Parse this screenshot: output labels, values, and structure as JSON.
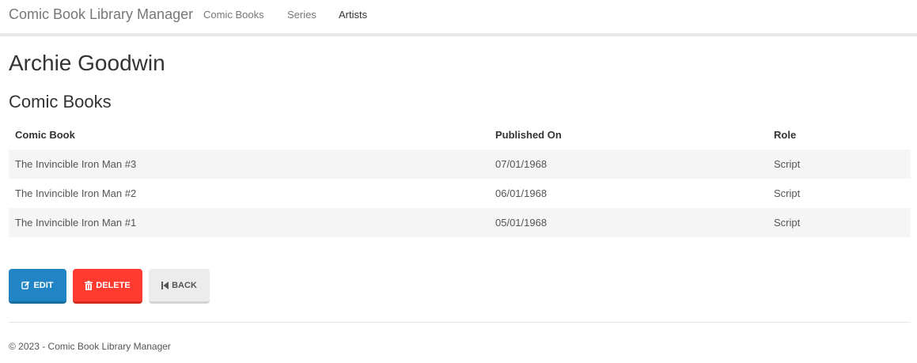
{
  "nav": {
    "brand": "Comic Book Library Manager",
    "links": [
      {
        "label": "Comic Books"
      },
      {
        "label": "Series"
      },
      {
        "label": "Artists"
      }
    ]
  },
  "page": {
    "title": "Archie Goodwin",
    "section_title": "Comic Books"
  },
  "table": {
    "headers": [
      "Comic Book",
      "Published On",
      "Role"
    ],
    "rows": [
      [
        "The Invincible Iron Man #3",
        "07/01/1968",
        "Script"
      ],
      [
        "The Invincible Iron Man #2",
        "06/01/1968",
        "Script"
      ],
      [
        "The Invincible Iron Man #1",
        "05/01/1968",
        "Script"
      ]
    ]
  },
  "buttons": {
    "edit": {
      "label": "EDIT",
      "icon": "edit-icon",
      "color": "#2185c5"
    },
    "delete": {
      "label": "DELETE",
      "icon": "trash-icon",
      "color": "#ff3b30"
    },
    "back": {
      "label": "BACK",
      "icon": "step-backward-icon",
      "color": "#ececec"
    }
  },
  "footer": {
    "text": "© 2023 - Comic Book Library Manager"
  }
}
